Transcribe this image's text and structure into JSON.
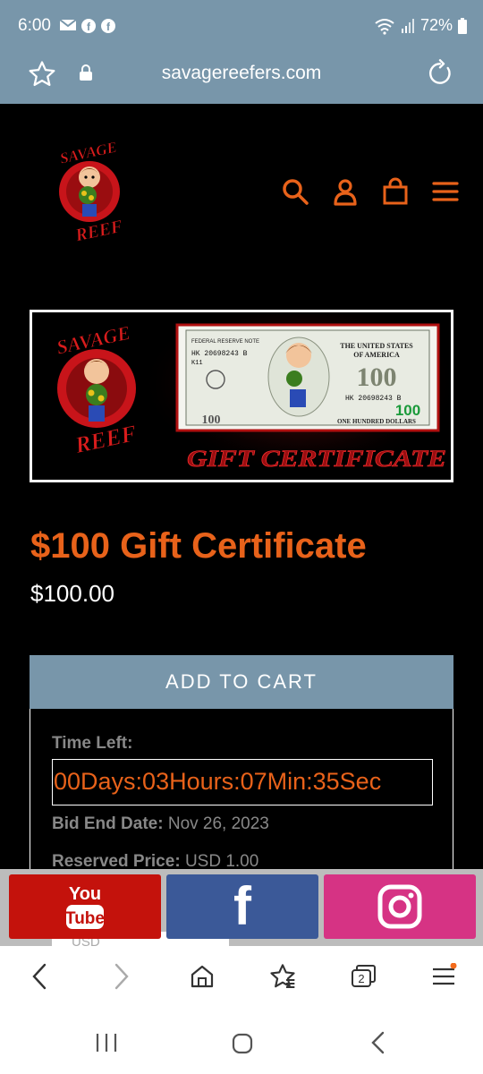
{
  "status": {
    "time": "6:00",
    "battery": "72%",
    "icons": [
      "mail-icon",
      "facebook-icon",
      "facebook-icon",
      "wifi-icon",
      "signal-icon",
      "battery-icon"
    ]
  },
  "browser": {
    "url": "savagereefers.com",
    "icons": [
      "star-icon",
      "lock-icon",
      "reload-icon"
    ]
  },
  "header": {
    "logo_text_top": "SAVAGE",
    "logo_text_bottom": "REEF",
    "icons": [
      "search-icon",
      "account-icon",
      "cart-icon",
      "menu-icon"
    ]
  },
  "hero": {
    "logo_text_top": "SAVAGE",
    "logo_text_bottom": "REEF",
    "bill_top_left": "FEDERAL RESERVE NOTE",
    "bill_serial": "HK 20698243 B",
    "bill_code": "K11",
    "bill_country_1": "THE UNITED STATES",
    "bill_country_2": "OF AMERICA",
    "bill_value": "100",
    "bill_bottom": "ONE HUNDRED DOLLARS",
    "caption": "GIFT CERTIFICATE"
  },
  "product": {
    "title": "$100 Gift Certificate",
    "price": "$100.00",
    "add_to_cart": "ADD TO CART"
  },
  "auction": {
    "time_left_label": "Time Left:",
    "countdown": "00Days:03Hours:07Min:35Sec",
    "bid_end_label": "Bid End Date:",
    "bid_end_value": "Nov 26, 2023",
    "reserved_label": "Reserved Price:",
    "reserved_value": "USD 1.00",
    "currency_partial": "USD"
  },
  "social": {
    "youtube_top": "You",
    "youtube_bottom": "Tube",
    "facebook": "f"
  },
  "bottom_nav": {
    "tabs_count": "2",
    "icons": [
      "back-icon",
      "forward-icon",
      "home-icon",
      "bookmarks-icon",
      "tabs-icon",
      "menu-icon"
    ]
  },
  "colors": {
    "accent": "#e8621a",
    "browser_bar": "#7896aa",
    "youtube": "#c4120c",
    "facebook": "#3b5998",
    "instagram": "#d63384"
  }
}
